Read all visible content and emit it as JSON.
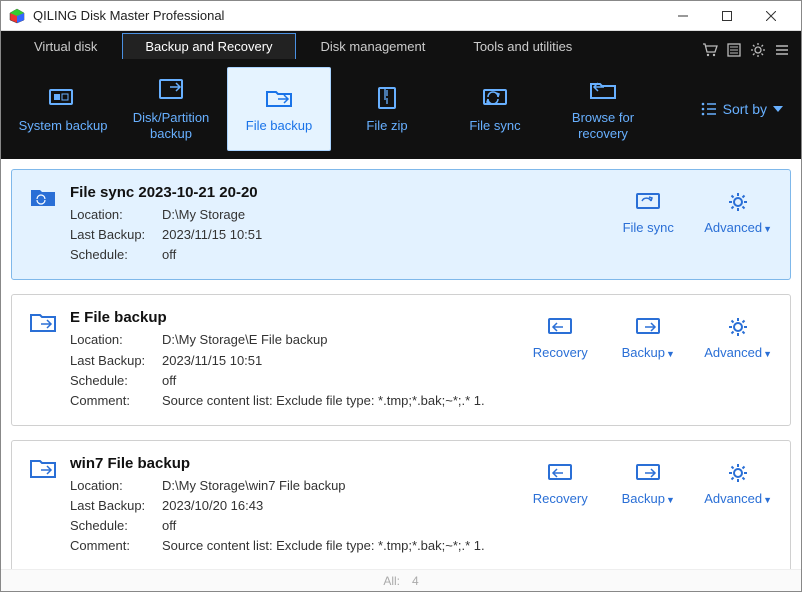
{
  "window": {
    "title": "QILING Disk Master Professional"
  },
  "tabs": [
    {
      "label": "Virtual disk"
    },
    {
      "label": "Backup and Recovery"
    },
    {
      "label": "Disk management"
    },
    {
      "label": "Tools and utilities"
    }
  ],
  "active_tab": 1,
  "toolbar": [
    {
      "label": "System backup"
    },
    {
      "label": "Disk/Partition backup"
    },
    {
      "label": "File backup"
    },
    {
      "label": "File zip"
    },
    {
      "label": "File sync"
    },
    {
      "label": "Browse for recovery"
    }
  ],
  "active_tool": 2,
  "sortby_label": "Sort by",
  "labels": {
    "location": "Location:",
    "last_backup": "Last Backup:",
    "schedule": "Schedule:",
    "comment": "Comment:",
    "recovery": "Recovery",
    "backup": "Backup",
    "file_sync": "File sync",
    "advanced": "Advanced"
  },
  "tasks": [
    {
      "name": "File sync 2023-10-21 20-20",
      "location": "D:\\My Storage",
      "last_backup": "2023/11/15 10:51",
      "schedule": "off",
      "comment": "",
      "selected": true,
      "type": "sync"
    },
    {
      "name": "E  File backup",
      "location": "D:\\My Storage\\E  File backup",
      "last_backup": "2023/11/15 10:51",
      "schedule": "off",
      "comment": "Source content list:  Exclude file type: *.tmp;*.bak;~*;.*      1.",
      "selected": false,
      "type": "backup"
    },
    {
      "name": "win7 File backup",
      "location": "D:\\My Storage\\win7 File backup",
      "last_backup": "2023/10/20 16:43",
      "schedule": "off",
      "comment": "Source content list:  Exclude file type: *.tmp;*.bak;~*;.*      1.",
      "selected": false,
      "type": "backup"
    }
  ],
  "footer": {
    "all_label": "All:",
    "count": "4"
  },
  "colors": {
    "accent": "#2a6fd6",
    "lightaccent": "#68b0ff"
  }
}
